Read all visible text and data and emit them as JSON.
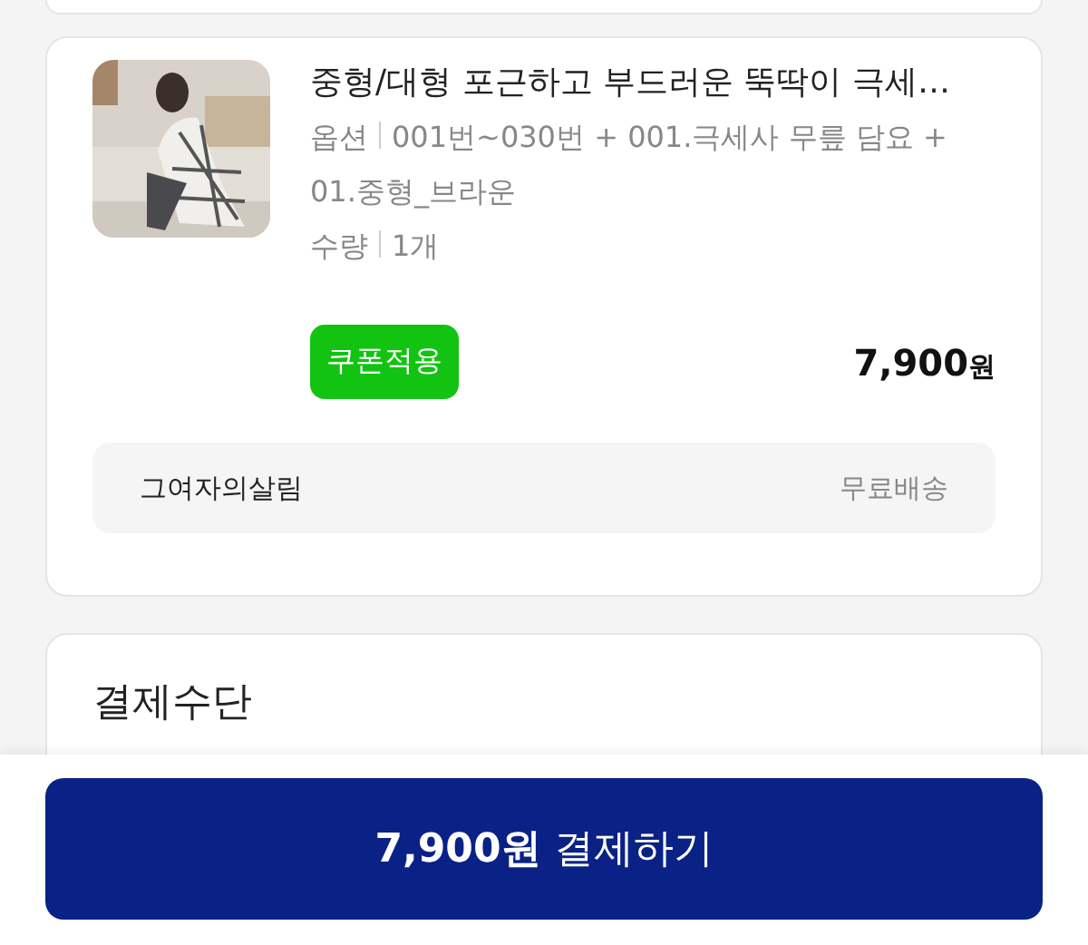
{
  "order_item": {
    "title": "중형/대형 포근하고 부드러운 뚝딱이 극세…",
    "details": [
      {
        "label": "옵션",
        "value": "001번~030번 + 001.극세사 무릎 담요 + 01.중형_브라운"
      },
      {
        "label": "수량",
        "value": "1개"
      }
    ],
    "coupon_button": "쿠폰적용",
    "price": {
      "amount": "7,900",
      "unit": "원"
    },
    "seller": {
      "name": "그여자의살림",
      "shipping": "무료배송"
    }
  },
  "payment": {
    "title": "결제수단"
  },
  "pay_button": "**7,900원** 결제하기"
}
